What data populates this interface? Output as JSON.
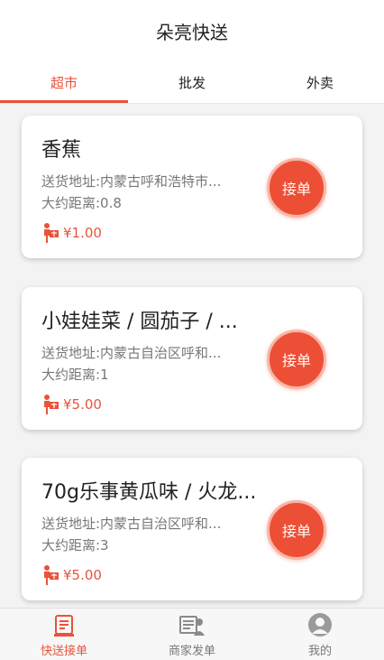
{
  "header": {
    "title": "朵亮快送"
  },
  "tabs": [
    {
      "label": "超市",
      "active": true
    },
    {
      "label": "批发",
      "active": false
    },
    {
      "label": "外卖",
      "active": false
    }
  ],
  "orders": [
    {
      "title": "香蕉",
      "address": "送货地址:内蒙古呼和浩特市...",
      "distance": "大约距离:0.8",
      "price": "¥1.00",
      "action": "接单"
    },
    {
      "title": "小娃娃菜 / 圆茄子 / ...",
      "address": "送货地址:内蒙古自治区呼和...",
      "distance": "大约距离:1",
      "price": "¥5.00",
      "action": "接单"
    },
    {
      "title": "70g乐事黄瓜味 / 火龙...",
      "address": "送货地址:内蒙古自治区呼和...",
      "distance": "大约距离:3",
      "price": "¥5.00",
      "action": "接单"
    }
  ],
  "bottom_nav": [
    {
      "label": "快送接单",
      "icon": "order-list-icon",
      "active": true
    },
    {
      "label": "商家发单",
      "icon": "merchant-dispatch-icon",
      "active": false
    },
    {
      "label": "我的",
      "icon": "user-icon",
      "active": false
    }
  ],
  "colors": {
    "accent": "#e8533b",
    "button": "#ec4f35"
  }
}
